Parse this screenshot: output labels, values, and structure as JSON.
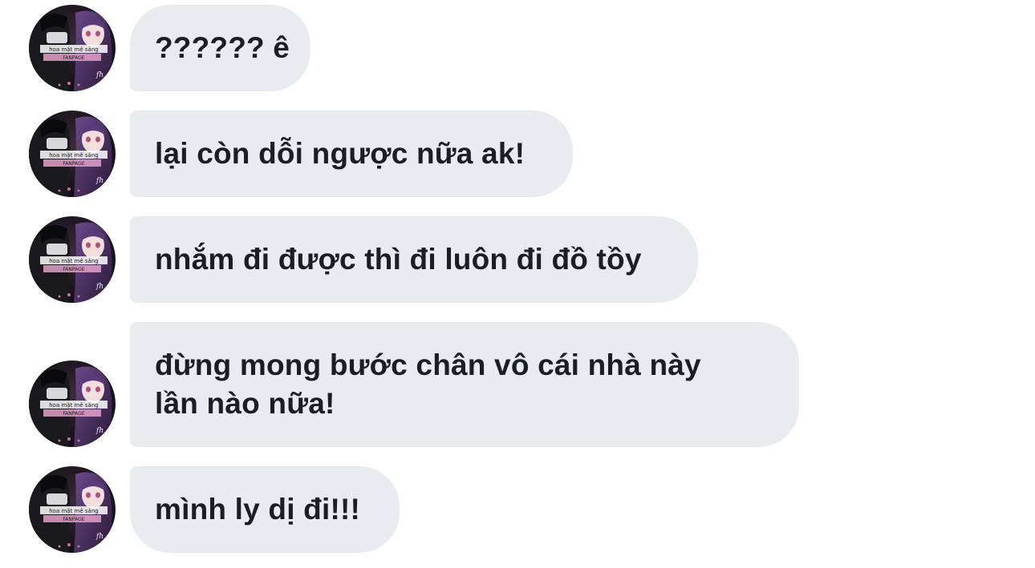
{
  "conversation": {
    "messages": [
      {
        "text": "?????? ê"
      },
      {
        "text": "lại còn dỗi ngược nữa ak!"
      },
      {
        "text": "nhắm đi được thì đi luôn đi đồ tồy"
      },
      {
        "lines": [
          "đừng mong bước chân vô cái nhà này",
          "lần nào nữa!"
        ]
      },
      {
        "text": "mình ly dị đi!!!"
      }
    ],
    "avatar": {
      "icon": "anime-girl-avatar-icon",
      "caption_top": "hoa mặt mê sảng",
      "caption_bottom": "FANPAGE"
    }
  },
  "colors": {
    "bubble_bg": "#e8ecf0",
    "text": "#1c1e21",
    "background": "#ffffff"
  }
}
